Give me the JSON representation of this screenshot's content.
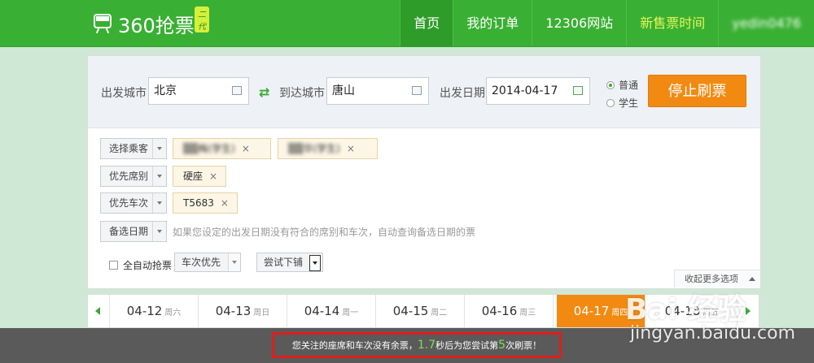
{
  "app": {
    "logo_text": "360抢票",
    "logo_badge": "二代"
  },
  "nav": {
    "items": [
      {
        "label": "首页",
        "active": true
      },
      {
        "label": "我的订单"
      },
      {
        "label": "12306网站"
      },
      {
        "label": "新售票时间",
        "highlight": true
      }
    ],
    "user": "yedin0476"
  },
  "search": {
    "from_label": "出发城市",
    "from_value": "北京",
    "to_label": "到达城市",
    "to_value": "唐山",
    "date_label": "出发日期",
    "date_value": "2014-04-17",
    "ticket_types": [
      {
        "label": "普通",
        "selected": true
      },
      {
        "label": "学生",
        "selected": false
      }
    ],
    "stop_button": "停止刷票"
  },
  "options": {
    "passenger_btn": "选择乘客",
    "passengers": [
      {
        "name": "▒▒梅",
        "suffix": "(学生)",
        "remove": "×"
      },
      {
        "name": "▒▒华",
        "suffix": "(学生)",
        "remove": "×"
      }
    ],
    "seat_btn": "优先席别",
    "seats": [
      {
        "name": "硬座",
        "remove": "×"
      }
    ],
    "train_btn": "优先车次",
    "trains": [
      {
        "name": "T5683",
        "remove": "×"
      }
    ],
    "alt_date_btn": "备选日期",
    "alt_date_hint": "如果您设定的出发日期没有符合的席别和车次，自动查询备选日期的票",
    "auto_label": "全自动抢票",
    "priority_select": "车次优先",
    "try_select": "尝试下铺",
    "collapse": "收起更多选项"
  },
  "dates": [
    {
      "date": "04-12",
      "weekday": "周六"
    },
    {
      "date": "04-13",
      "weekday": "周日"
    },
    {
      "date": "04-14",
      "weekday": "周一"
    },
    {
      "date": "04-15",
      "weekday": "周二"
    },
    {
      "date": "04-16",
      "weekday": "周三"
    },
    {
      "date": "04-17",
      "weekday": "周四",
      "active": true
    },
    {
      "date": "04-18",
      "weekday": "周五"
    }
  ],
  "status": {
    "prefix": "您关注的座席和车次没有余票，",
    "seconds": "1.7",
    "middle": "秒后为您尝试第",
    "count": "5",
    "suffix": "次刷票！"
  },
  "watermark": {
    "top": "Bai 经验",
    "bottom": "jingyan.baidu.com"
  },
  "colors": {
    "brand_green": "#39b033",
    "accent_orange": "#f28a12",
    "alert_red": "#e01d1d"
  }
}
